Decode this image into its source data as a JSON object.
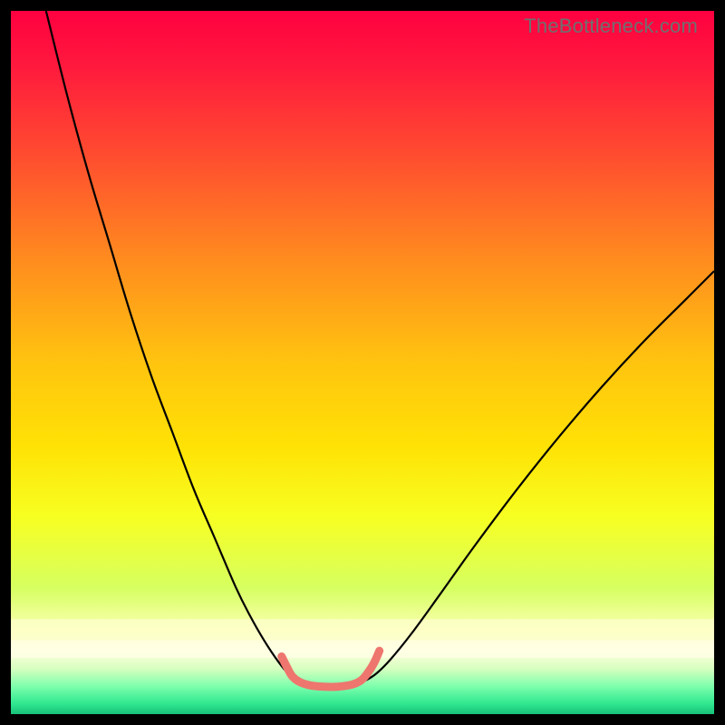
{
  "watermark": "TheBottleneck.com",
  "chart_data": {
    "type": "line",
    "title": "",
    "xlabel": "",
    "ylabel": "",
    "xlim": [
      0,
      100
    ],
    "ylim": [
      0,
      100
    ],
    "grid": false,
    "legend": false,
    "background": {
      "type": "vertical-gradient",
      "stops": [
        {
          "pos": 0.0,
          "color": "#ff0040"
        },
        {
          "pos": 0.08,
          "color": "#ff1a3d"
        },
        {
          "pos": 0.2,
          "color": "#ff4a30"
        },
        {
          "pos": 0.35,
          "color": "#ff8a1f"
        },
        {
          "pos": 0.5,
          "color": "#ffc40f"
        },
        {
          "pos": 0.62,
          "color": "#ffe205"
        },
        {
          "pos": 0.72,
          "color": "#f7ff22"
        },
        {
          "pos": 0.82,
          "color": "#d6ff60"
        },
        {
          "pos": 0.88,
          "color": "#faffb0"
        },
        {
          "pos": 0.91,
          "color": "#ffffdc"
        },
        {
          "pos": 0.935,
          "color": "#d8ffc0"
        },
        {
          "pos": 0.96,
          "color": "#7fffad"
        },
        {
          "pos": 0.985,
          "color": "#30e890"
        },
        {
          "pos": 1.0,
          "color": "#18c078"
        }
      ]
    },
    "overlay_bands": [
      {
        "y0": 86.5,
        "y1": 89.5,
        "color": "#fdffce",
        "alpha": 0.72
      },
      {
        "y0": 89.5,
        "y1": 92.0,
        "color": "#ffffe6",
        "alpha": 0.78
      }
    ],
    "series": [
      {
        "name": "left-curve",
        "stroke": "#000000",
        "stroke_width": 2.2,
        "x": [
          5,
          8,
          11,
          14,
          17,
          20,
          23,
          26,
          29,
          32,
          34,
          36,
          38,
          39.5,
          40.8
        ],
        "y": [
          0,
          12,
          23,
          33,
          43,
          52,
          60,
          68,
          75,
          82,
          86,
          89.5,
          92.5,
          94.3,
          95.2
        ]
      },
      {
        "name": "right-curve",
        "stroke": "#000000",
        "stroke_width": 2.2,
        "x": [
          50.5,
          52,
          54,
          57,
          61,
          66,
          72,
          78,
          84,
          90,
          96,
          100
        ],
        "y": [
          95.2,
          94.2,
          92.2,
          88.5,
          83.0,
          76.0,
          68.0,
          60.5,
          53.5,
          47.0,
          41.0,
          37.0
        ]
      },
      {
        "name": "valley-highlight",
        "stroke": "#ee766e",
        "stroke_width": 9,
        "linecap": "round",
        "x": [
          38.5,
          39.3,
          40.0,
          41.0,
          42.5,
          44.5,
          46.5,
          48.5,
          49.8,
          50.7,
          51.6,
          52.4
        ],
        "y": [
          91.8,
          93.4,
          94.6,
          95.4,
          95.9,
          96.1,
          96.1,
          95.8,
          95.2,
          94.2,
          92.8,
          91.0
        ]
      }
    ]
  }
}
